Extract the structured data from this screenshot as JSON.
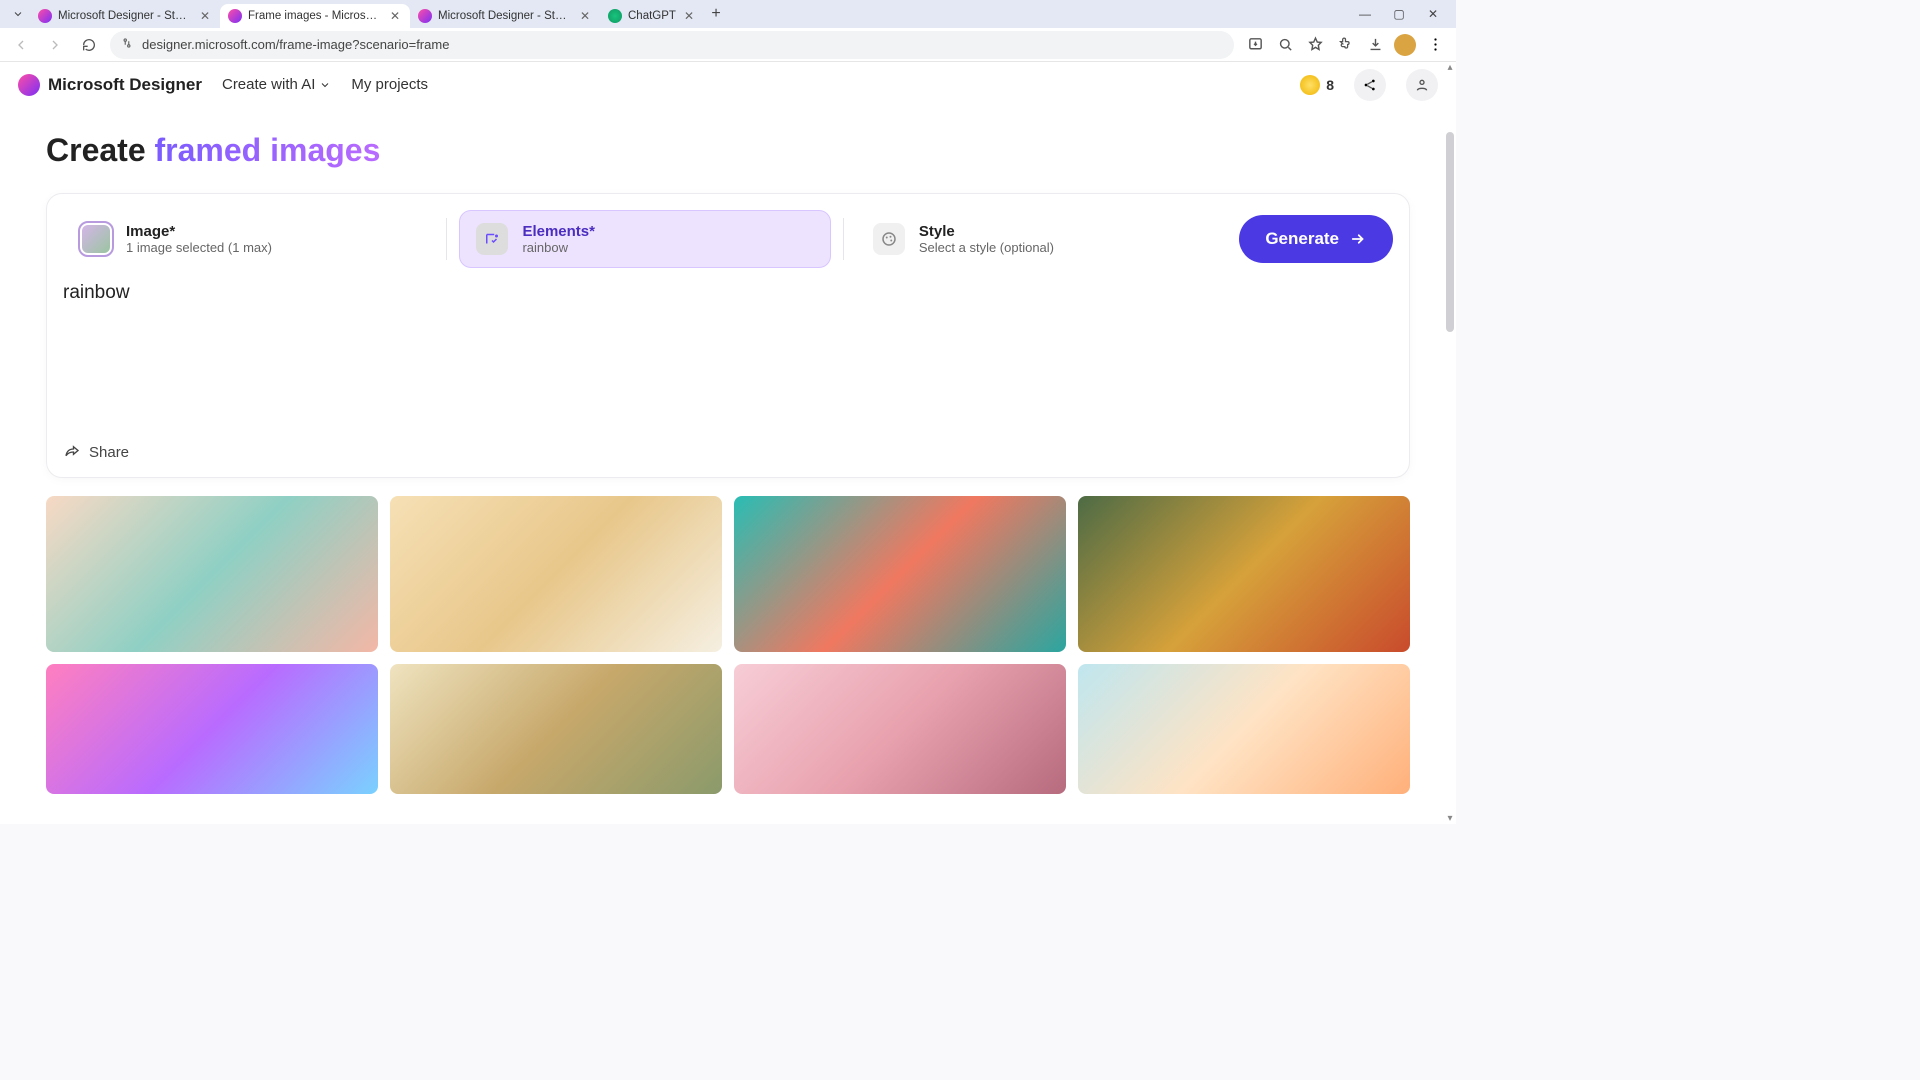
{
  "browser": {
    "tabs": [
      {
        "title": "Microsoft Designer - Stunning",
        "active": false,
        "favicon": "designer"
      },
      {
        "title": "Frame images - Microsoft Des",
        "active": true,
        "favicon": "designer"
      },
      {
        "title": "Microsoft Designer - Stunning",
        "active": false,
        "favicon": "designer"
      },
      {
        "title": "ChatGPT",
        "active": false,
        "favicon": "chatgpt"
      }
    ],
    "url": "designer.microsoft.com/frame-image?scenario=frame"
  },
  "app_header": {
    "brand": "Microsoft Designer",
    "nav": {
      "create_with_ai": "Create with AI",
      "my_projects": "My projects"
    },
    "coins": "8"
  },
  "page_title": {
    "prefix": "Create ",
    "highlight": "framed images"
  },
  "options": {
    "image": {
      "label": "Image*",
      "subtitle": "1 image selected (1 max)"
    },
    "elements": {
      "label": "Elements*",
      "subtitle": "rainbow"
    },
    "style": {
      "label": "Style",
      "subtitle": "Select a style (optional)"
    }
  },
  "generate_label": "Generate",
  "elements_input_value": "rainbow",
  "share_label": "Share",
  "gallery_tiles": [
    "baby-frame",
    "cats-frame",
    "music-frame",
    "harvest-frame",
    "cupcakes-frame",
    "floral-frame",
    "roses-frame",
    "autumn-frame"
  ]
}
